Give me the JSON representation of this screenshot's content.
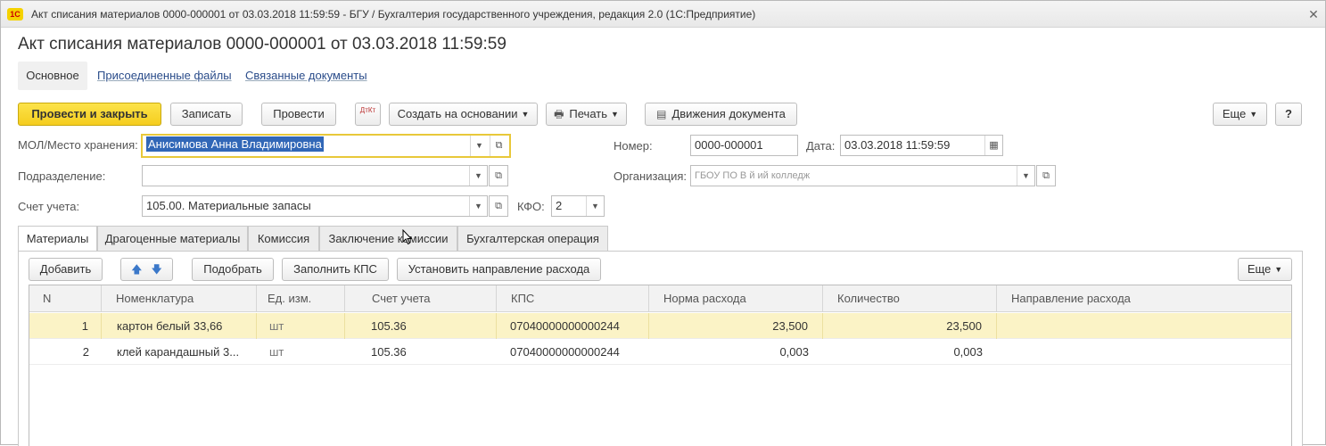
{
  "window": {
    "title": "Акт списания материалов 0000-000001 от 03.03.2018 11:59:59 - БГУ / Бухгалтерия государственного учреждения, редакция 2.0  (1С:Предприятие)",
    "logo_text": "1С",
    "close_glyph": "✕"
  },
  "document": {
    "title": "Акт списания материалов 0000-000001 от 03.03.2018 11:59:59"
  },
  "nav_tabs": {
    "main": "Основное",
    "attached_files": "Присоединенные файлы",
    "related_docs": "Связанные документы"
  },
  "toolbar": {
    "post_close": "Провести и закрыть",
    "save": "Записать",
    "post": "Провести",
    "dt_kt": "ДтКт",
    "create_based": "Создать на основании",
    "print": "Печать",
    "movements": "Движения документа",
    "more": "Еще",
    "help": "?"
  },
  "form": {
    "mol_label": "МОЛ/Место хранения:",
    "mol_value": "Анисимова Анна Владимировна",
    "subdivision_label": "Подразделение:",
    "subdivision_value": "",
    "account_label": "Счет учета:",
    "account_value": "105.00. Материальные запасы",
    "kfo_label": "КФО:",
    "kfo_value": "2",
    "number_label": "Номер:",
    "number_value": "0000-000001",
    "date_label": "Дата:",
    "date_value": "03.03.2018 11:59:59",
    "org_label": "Организация:",
    "org_value": "ГБОУ ПО В                  й                    ий колледж"
  },
  "tabs": [
    {
      "label": "Материалы"
    },
    {
      "label": "Драгоценные материалы"
    },
    {
      "label": "Комиссия"
    },
    {
      "label": "Заключение комиссии"
    },
    {
      "label": "Бухгалтерская операция"
    }
  ],
  "tab_toolbar": {
    "add": "Добавить",
    "up": "🡅",
    "down": "🡇",
    "pick": "Подобрать",
    "fill_kps": "Заполнить КПС",
    "set_direction": "Установить направление расхода",
    "more": "Еще"
  },
  "grid": {
    "columns": [
      "N",
      "Номенклатура",
      "Ед. изм.",
      "Счет учета",
      "КПС",
      "Норма расхода",
      "Количество",
      "Направление расхода"
    ],
    "rows": [
      {
        "n": "1",
        "item": "картон белый 33,66",
        "unit": "шт",
        "account": "105.36",
        "kps": "07040000000000244",
        "norm": "23,500",
        "qty": "23,500",
        "direction": ""
      },
      {
        "n": "2",
        "item": "клей карандашный 3...",
        "unit": "шт",
        "account": "105.36",
        "kps": "07040000000000244",
        "norm": "0,003",
        "qty": "0,003",
        "direction": ""
      }
    ]
  },
  "colors": {
    "primary_button": "#f5cd1e",
    "selected_row": "#fbf3c6",
    "selection": "#3167b7",
    "link": "#2a4c8a"
  }
}
